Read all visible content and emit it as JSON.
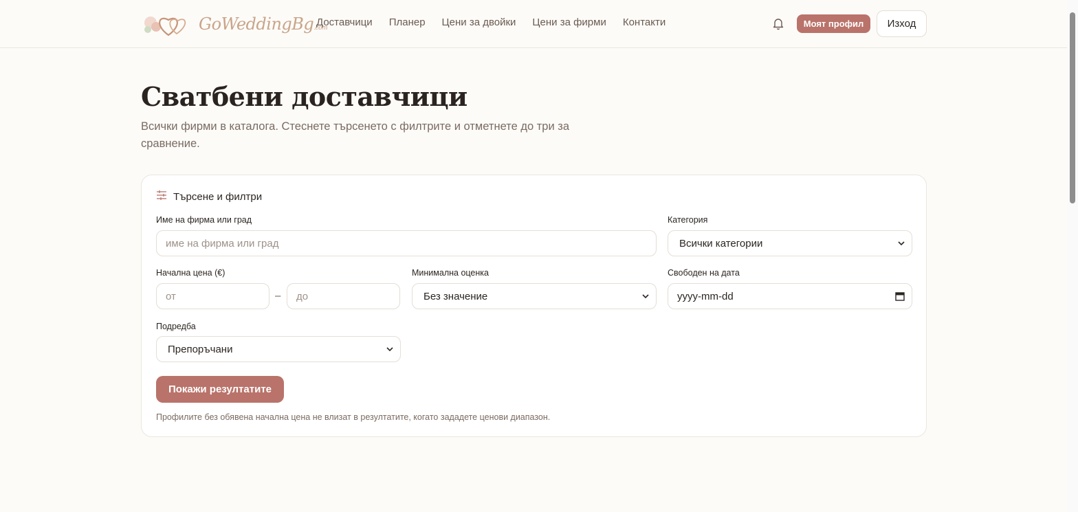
{
  "header": {
    "logo_text": "GoWeddingBg",
    "logo_suffix": ".com",
    "nav": [
      "Доставчици",
      "Планер",
      "Цени за двойки",
      "Цени за фирми",
      "Контакти"
    ],
    "profile_button": "Моят профил",
    "logout_button": "Изход",
    "bell_icon": "bell-icon"
  },
  "page": {
    "title": "Сватбени доставчици",
    "subtitle": "Всички фирми в каталога. Стеснете търсенето с филтрите и отметнете до три за сравнение."
  },
  "filters": {
    "heading": "Търсене и филтри",
    "heading_icon": "sliders-icon",
    "search_label": "Име на фирма или град",
    "search_placeholder": "име на фирма или град",
    "category_label": "Категория",
    "category_value": "Всички категории",
    "price_label": "Начална цена (€)",
    "price_from_placeholder": "от",
    "price_dash": "–",
    "price_to_placeholder": "до",
    "rating_label": "Минимална оценка",
    "rating_value": "Без значение",
    "date_label": "Свободен на дата",
    "date_placeholder": "yyyy-mm-dd",
    "sort_label": "Подредба",
    "sort_value": "Препоръчани",
    "submit_button": "Покажи резултатите",
    "note": "Профилите без обявена начална цена не влизат в резултатите, когато зададете ценови диапазон."
  },
  "colors": {
    "accent": "#b9736a",
    "background": "#fcfbf8",
    "text_muted": "#7a6b61"
  }
}
